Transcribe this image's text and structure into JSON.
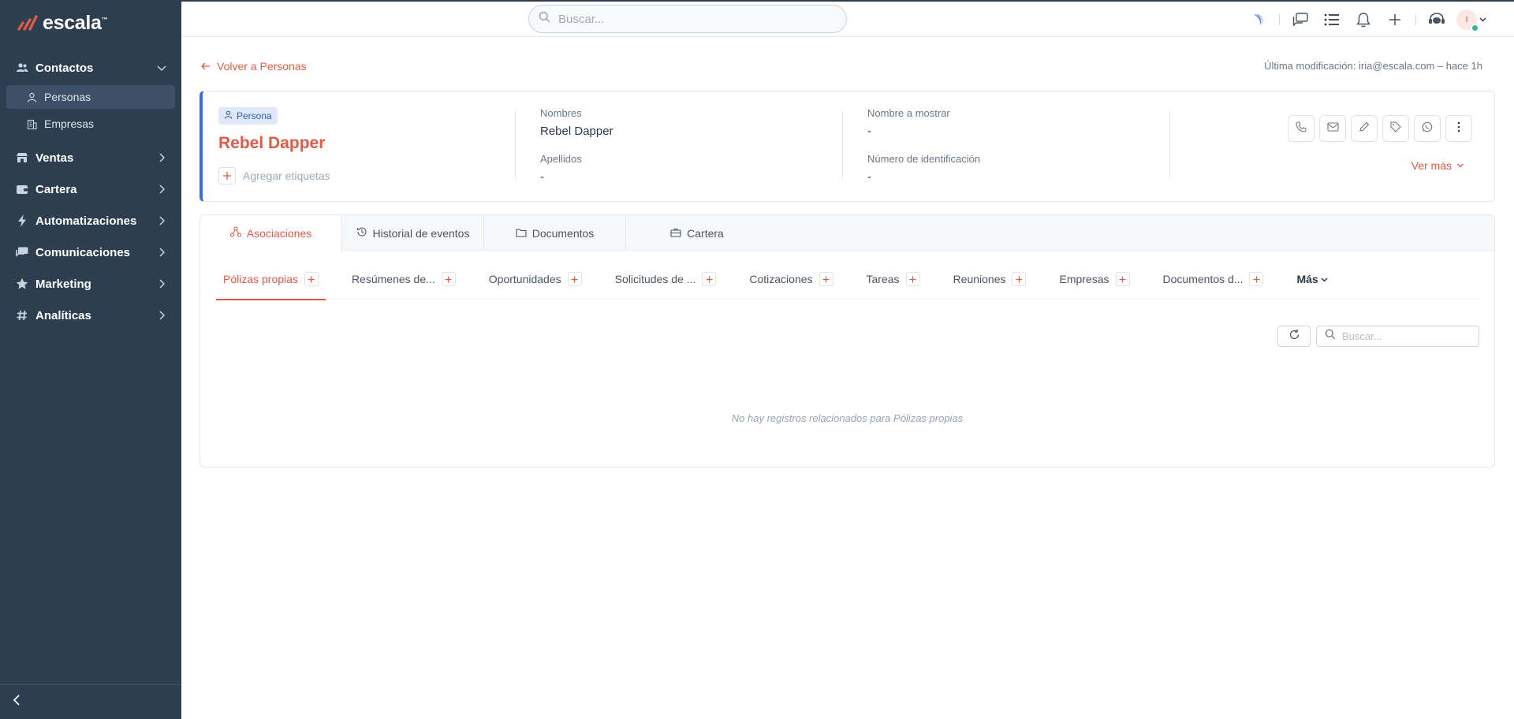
{
  "brand": {
    "name": "escala",
    "tm": "™",
    "logo_color": "#e05a47"
  },
  "sidebar": {
    "groups": [
      {
        "label": "Contactos",
        "icon": "users-icon",
        "expanded": true,
        "items": [
          {
            "label": "Personas",
            "icon": "user-icon",
            "active": true
          },
          {
            "label": "Empresas",
            "icon": "building-icon",
            "active": false
          }
        ]
      },
      {
        "label": "Ventas",
        "icon": "store-icon"
      },
      {
        "label": "Cartera",
        "icon": "wallet-icon"
      },
      {
        "label": "Automatizaciones",
        "icon": "bolt-icon"
      },
      {
        "label": "Comunicaciones",
        "icon": "chat-icon"
      },
      {
        "label": "Marketing",
        "icon": "star-icon"
      },
      {
        "label": "Analíticas",
        "icon": "hash-icon"
      }
    ]
  },
  "topbar": {
    "search_placeholder": "Buscar...",
    "avatar_initial": "I"
  },
  "back_link": "Volver a Personas",
  "last_modified": "Última modificación: iria@escala.com – hace 1h",
  "record": {
    "badge": "Persona",
    "name": "Rebel Dapper",
    "add_tags": "Agregar etiquetas",
    "fields": {
      "nombres_label": "Nombres",
      "nombres_value": "Rebel Dapper",
      "apellidos_label": "Apellidos",
      "apellidos_value": "-",
      "mostrar_label": "Nombre a mostrar",
      "mostrar_value": "-",
      "identificacion_label": "Número de identificación",
      "identificacion_value": "-"
    },
    "ver_mas": "Ver más"
  },
  "main_tabs": [
    "Asociaciones",
    "Historial de eventos",
    "Documentos",
    "Cartera"
  ],
  "sub_tabs": [
    "Pólizas propias",
    "Resúmenes de...",
    "Oportunidades",
    "Solicitudes de ...",
    "Cotizaciones",
    "Tareas",
    "Reuniones",
    "Empresas",
    "Documentos d..."
  ],
  "more_label": "Más",
  "table_search_placeholder": "Buscar...",
  "empty_message": "No hay registros relacionados para Pólizas propias",
  "colors": {
    "accent": "#e05a47",
    "sidebar": "#2c3e50",
    "card_border": "#3b6fd8"
  }
}
